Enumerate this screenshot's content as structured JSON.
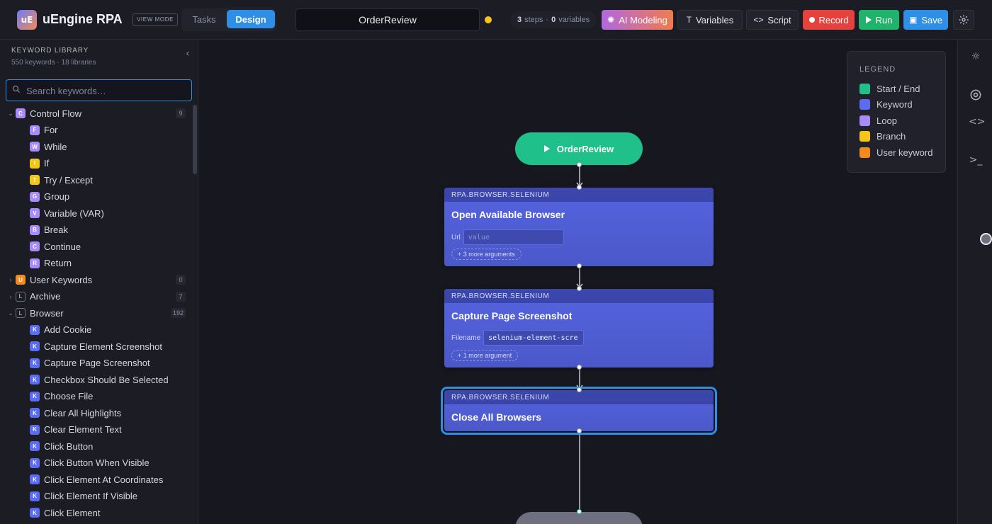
{
  "header": {
    "logo_text": "uE",
    "app_title": "uEngine RPA",
    "mode_badge": "VIEW MODE",
    "tabs": [
      {
        "label": "Tasks"
      },
      {
        "label": "Design",
        "active": true
      }
    ],
    "task_name": "OrderReview",
    "stats": {
      "steps": "3",
      "steps_label": "steps",
      "variables": "0",
      "variables_label": "variables"
    },
    "buttons": {
      "ai": "AI Modeling",
      "variables": "Variables",
      "script": "Script",
      "record": "Record",
      "run": "Run",
      "save": "Save"
    },
    "colors": {
      "accent": "#2f8fe6",
      "record": "#e5423e",
      "run": "#20b36b",
      "unsaved": "#f5c518"
    }
  },
  "sidebar": {
    "title": "KEYWORD LIBRARY",
    "subtitle": "550 keywords · 18 libraries",
    "search_placeholder": "Search keywords…",
    "groups": [
      {
        "name": "Control Flow",
        "badge": "C",
        "count": "9",
        "expanded": true,
        "items": [
          {
            "label": "For",
            "badge": "F"
          },
          {
            "label": "While",
            "badge": "W"
          },
          {
            "label": "If",
            "badge": "I"
          },
          {
            "label": "Try / Except",
            "badge": "T"
          },
          {
            "label": "Group",
            "badge": "G"
          },
          {
            "label": "Variable (VAR)",
            "badge": "V"
          },
          {
            "label": "Break",
            "badge": "B"
          },
          {
            "label": "Continue",
            "badge": "C"
          },
          {
            "label": "Return",
            "badge": "R"
          }
        ]
      },
      {
        "name": "User Keywords",
        "badge": "U",
        "count": "0",
        "expanded": false
      },
      {
        "name": "Archive",
        "badge": "L",
        "count": "7",
        "expanded": false
      },
      {
        "name": "Browser",
        "badge": "L",
        "count": "192",
        "expanded": true,
        "items": [
          {
            "label": "Add Cookie",
            "badge": "K"
          },
          {
            "label": "Capture Element Screenshot",
            "badge": "K"
          },
          {
            "label": "Capture Page Screenshot",
            "badge": "K"
          },
          {
            "label": "Checkbox Should Be Selected",
            "badge": "K"
          },
          {
            "label": "Choose File",
            "badge": "K"
          },
          {
            "label": "Clear All Highlights",
            "badge": "K"
          },
          {
            "label": "Clear Element Text",
            "badge": "K"
          },
          {
            "label": "Click Button",
            "badge": "K"
          },
          {
            "label": "Click Button When Visible",
            "badge": "K"
          },
          {
            "label": "Click Element At Coordinates",
            "badge": "K"
          },
          {
            "label": "Click Element If Visible",
            "badge": "K"
          },
          {
            "label": "Click Element",
            "badge": "K"
          }
        ]
      }
    ]
  },
  "legend": {
    "title": "LEGEND",
    "items": [
      {
        "label": "Start / End",
        "color": "#20c08a"
      },
      {
        "label": "Keyword",
        "color": "#5a6cf0"
      },
      {
        "label": "Loop",
        "color": "#a78bfa"
      },
      {
        "label": "Branch",
        "color": "#f5c518"
      },
      {
        "label": "User keyword",
        "color": "#f28a1e"
      }
    ]
  },
  "flow": {
    "start_label": "OrderReview",
    "nodes": [
      {
        "library": "RPA.BROWSER.SELENIUM",
        "title": "Open Available Browser",
        "arg_label": "Url",
        "arg_value": "",
        "arg_placeholder": "value",
        "more": "+ 3 more arguments"
      },
      {
        "library": "RPA.BROWSER.SELENIUM",
        "title": "Capture Page Screenshot",
        "arg_label": "Filename",
        "arg_value": "selenium-element-scre",
        "more": "+ 1 more argument"
      },
      {
        "library": "RPA.BROWSER.SELENIUM",
        "title": "Close All Browsers",
        "selected": true
      }
    ]
  },
  "badge_colors": {
    "control": "#a78bfa",
    "if": "#f5c518",
    "user": "#f28a1e",
    "keyword": "#5a6cf0"
  }
}
